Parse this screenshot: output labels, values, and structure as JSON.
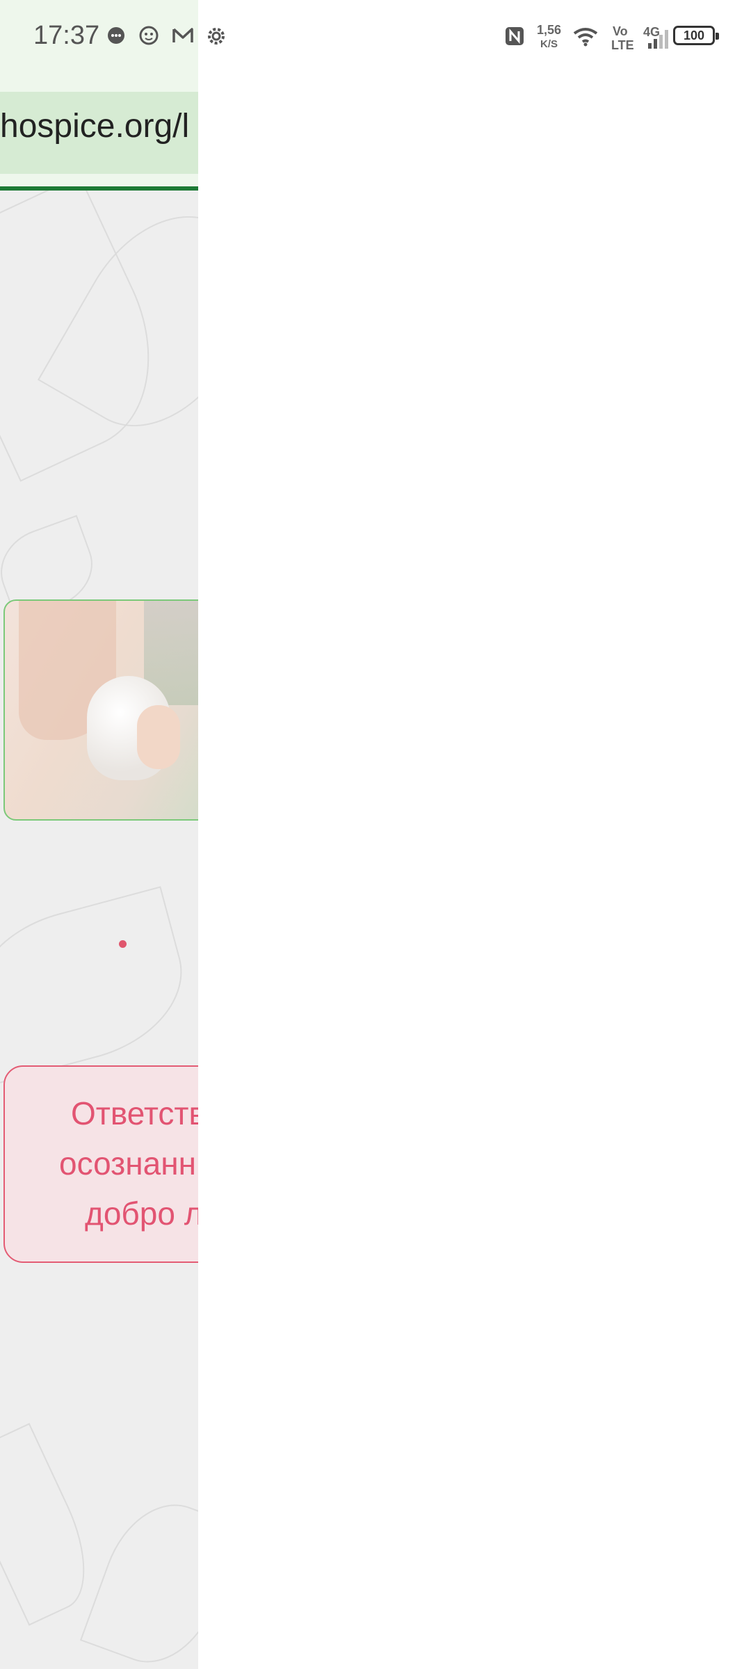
{
  "status_bar": {
    "time": "17:37",
    "network_speed_value": "1,56",
    "network_speed_unit": "K/S",
    "vo_top": "Vo",
    "vo_bottom": "LTE",
    "network_type": "4G",
    "battery_level": "100",
    "icons": [
      "chat-bubble-icon",
      "face-icon",
      "gmail-icon",
      "settings-icon",
      "nfc-icon",
      "wifi-icon",
      "signal-icon",
      "battery-icon"
    ]
  },
  "browser": {
    "url_fragment": "hospice.org/l",
    "progress_color": "#1d7a35"
  },
  "content": {
    "quote_lines": [
      "Ответств",
      "осознанн",
      "добро л"
    ],
    "accent_color": "#e35c74",
    "hero_border_color": "#7cc97a"
  }
}
